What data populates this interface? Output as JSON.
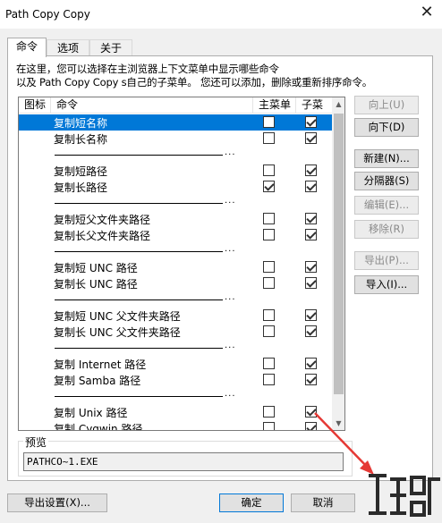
{
  "window": {
    "title": "Path Copy Copy"
  },
  "tabs": [
    "命令",
    "选项",
    "关于"
  ],
  "description": {
    "line1": "在这里，您可以选择在主浏览器上下文菜单中显示哪些命令",
    "line2": "以及 Path Copy Copy s自己的子菜单。 您还可以添加，删除或重新排序命令。"
  },
  "table": {
    "headers": {
      "icon": "图标",
      "command": "命令",
      "main_menu": "主菜单",
      "submenu": "子菜单"
    },
    "separator_dots": "...",
    "rows": [
      {
        "type": "item",
        "name": "复制短名称",
        "main": false,
        "sub": true,
        "selected": true
      },
      {
        "type": "item",
        "name": "复制长名称",
        "main": false,
        "sub": true
      },
      {
        "type": "separator"
      },
      {
        "type": "item",
        "name": "复制短路径",
        "main": false,
        "sub": true
      },
      {
        "type": "item",
        "name": "复制长路径",
        "main": true,
        "sub": true
      },
      {
        "type": "separator"
      },
      {
        "type": "item",
        "name": "复制短父文件夹路径",
        "main": false,
        "sub": true
      },
      {
        "type": "item",
        "name": "复制长父文件夹路径",
        "main": false,
        "sub": true
      },
      {
        "type": "separator"
      },
      {
        "type": "item",
        "name": "复制短 UNC 路径",
        "main": false,
        "sub": true
      },
      {
        "type": "item",
        "name": "复制长 UNC 路径",
        "main": false,
        "sub": true
      },
      {
        "type": "separator"
      },
      {
        "type": "item",
        "name": "复制短 UNC 父文件夹路径",
        "main": false,
        "sub": true
      },
      {
        "type": "item",
        "name": "复制长 UNC 父文件夹路径",
        "main": false,
        "sub": true
      },
      {
        "type": "separator"
      },
      {
        "type": "item",
        "name": "复制 Internet 路径",
        "main": false,
        "sub": true
      },
      {
        "type": "item",
        "name": "复制 Samba 路径",
        "main": false,
        "sub": true
      },
      {
        "type": "separator"
      },
      {
        "type": "item",
        "name": "复制 Unix 路径",
        "main": false,
        "sub": true
      },
      {
        "type": "item",
        "name": "复制 Cygwin 路径",
        "main": false,
        "sub": true
      }
    ]
  },
  "side_buttons": {
    "up": "向上(U)",
    "down": "向下(D)",
    "new": "新建(N)...",
    "separator": "分隔器(S)",
    "edit": "编辑(E)...",
    "remove": "移除(R)",
    "export": "导出(P)...",
    "import": "导入(I)..."
  },
  "preview": {
    "label": "预览",
    "value": "PATHCO~1.EXE"
  },
  "footer": {
    "export_settings": "导出设置(X)...",
    "ok": "确定",
    "cancel": "取消"
  },
  "colors": {
    "selection": "#0078d7",
    "annotation_arrow": "#e53935"
  },
  "icons": {
    "close": "close-icon",
    "scroll_up": "scroll-up-arrow-icon",
    "scroll_down": "scroll-down-arrow-icon"
  }
}
